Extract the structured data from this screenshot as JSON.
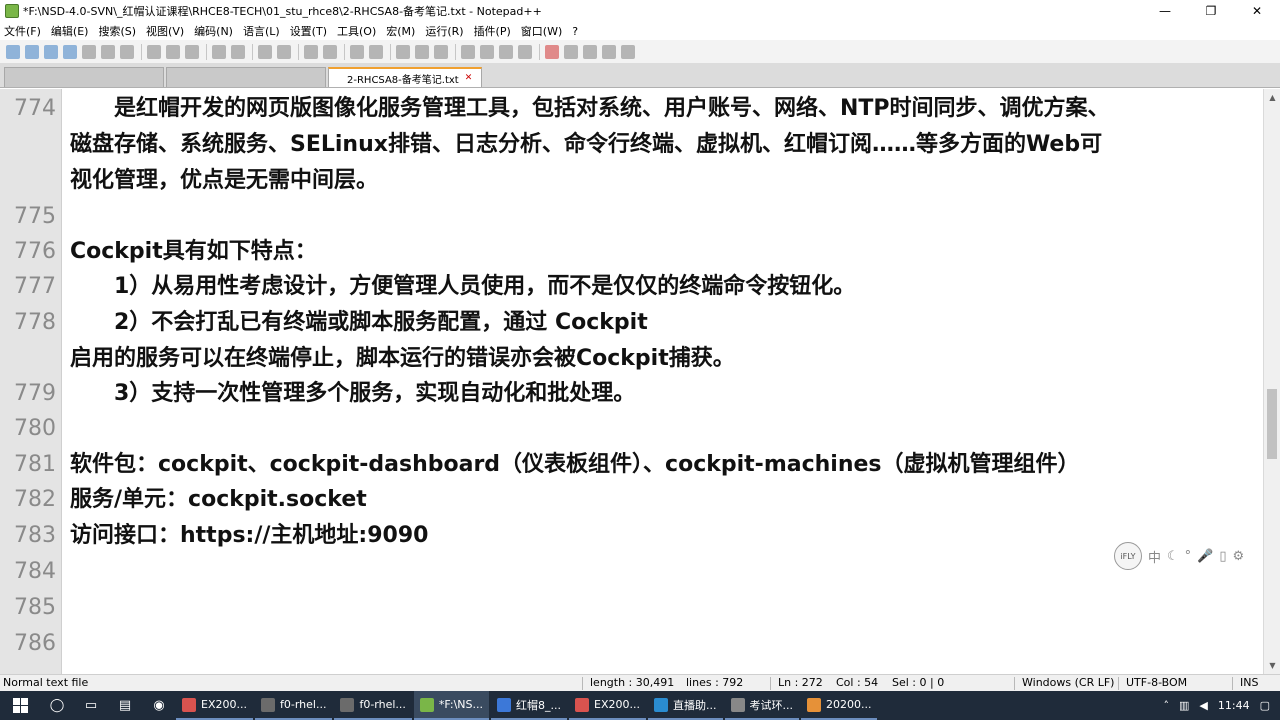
{
  "window": {
    "title": "*F:\\NSD-4.0-SVN\\_红帽认证课程\\RHCE8-TECH\\01_stu_rhce8\\2-RHCSA8-备考笔记.txt - Notepad++",
    "minimize": "—",
    "maximize": "❐",
    "close": "✕"
  },
  "menu": [
    "文件(F)",
    "编辑(E)",
    "搜索(S)",
    "视图(V)",
    "编码(N)",
    "语言(L)",
    "设置(T)",
    "工具(O)",
    "宏(M)",
    "运行(R)",
    "插件(P)",
    "窗口(W)",
    "?"
  ],
  "tabs": [
    {
      "label": "",
      "active": false
    },
    {
      "label": "",
      "active": false
    },
    {
      "label": "2-RHCSA8-备考笔记.txt",
      "active": true,
      "close": "✕"
    }
  ],
  "editor": {
    "lines": [
      {
        "num": "774",
        "text": "　　是红帽开发的网页版图像化服务管理工具，包括对系统、用户账号、网络、NTP时间同步、调优方案、"
      },
      {
        "num": "",
        "text": "磁盘存储、系统服务、SELinux排错、日志分析、命令行终端、虚拟机、红帽订阅……等多方面的Web可"
      },
      {
        "num": "",
        "text": "视化管理，优点是无需中间层。"
      },
      {
        "num": "775",
        "text": ""
      },
      {
        "num": "776",
        "text": "Cockpit具有如下特点："
      },
      {
        "num": "777",
        "text": "　　1）从易用性考虑设计，方便管理人员使用，而不是仅仅的终端命令按钮化。"
      },
      {
        "num": "778",
        "text": "　　2）不会打乱已有终端或脚本服务配置，通过 Cockpit"
      },
      {
        "num": "",
        "text": "启用的服务可以在终端停止，脚本运行的错误亦会被Cockpit捕获。"
      },
      {
        "num": "779",
        "text": "　　3）支持一次性管理多个服务，实现自动化和批处理。"
      },
      {
        "num": "780",
        "text": ""
      },
      {
        "num": "781",
        "text": "软件包：cockpit、cockpit-dashboard（仪表板组件）、cockpit-machines（虚拟机管理组件）"
      },
      {
        "num": "782",
        "text": "服务/单元：cockpit.socket"
      },
      {
        "num": "783",
        "text": "访问接口：https://主机地址:9090"
      },
      {
        "num": "784",
        "text": ""
      },
      {
        "num": "785",
        "text": ""
      },
      {
        "num": "786",
        "text": ""
      }
    ]
  },
  "ifly": {
    "logo": "iFLY",
    "icons": [
      "中",
      "☾",
      "°",
      "🎤",
      "▯",
      "⚙"
    ]
  },
  "status": {
    "type": "Normal text file",
    "length": "length : 30,491",
    "lines": "lines : 792",
    "ln": "Ln : 272",
    "col": "Col : 54",
    "sel": "Sel : 0 | 0",
    "eol": "Windows (CR LF)",
    "encoding": "UTF-8-BOM",
    "mode": "INS"
  },
  "taskbar": {
    "apps": [
      {
        "label": "EX200...",
        "color": "#d9534f"
      },
      {
        "label": "f0-rhel...",
        "color": "#6b6b6b"
      },
      {
        "label": "f0-rhel...",
        "color": "#6b6b6b"
      },
      {
        "label": "*F:\\NS...",
        "color": "#7ab648",
        "active": true
      },
      {
        "label": "红帽8_...",
        "color": "#3c78d8"
      },
      {
        "label": "EX200...",
        "color": "#d9534f"
      },
      {
        "label": "直播助...",
        "color": "#2a8cd0"
      },
      {
        "label": "考试环...",
        "color": "#888888"
      },
      {
        "label": "20200...",
        "color": "#e69138"
      }
    ],
    "time": "11:44"
  }
}
